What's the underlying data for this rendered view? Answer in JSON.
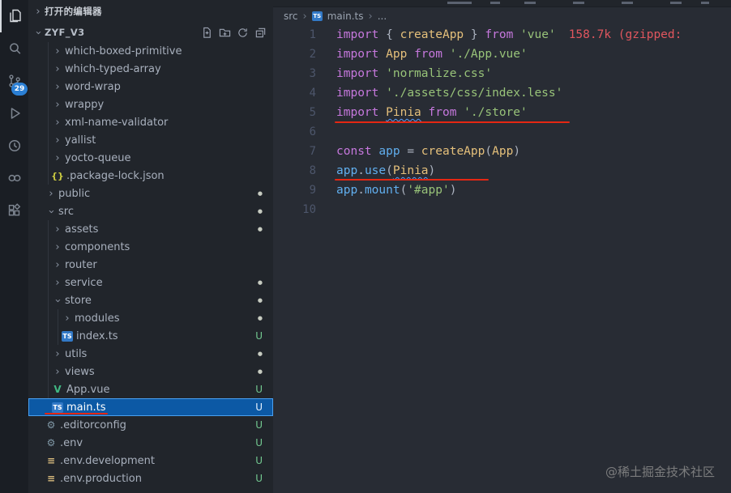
{
  "activity_bar": {
    "source_control_badge": "29",
    "icons": [
      {
        "name": "explorer-icon"
      },
      {
        "name": "search-icon"
      },
      {
        "name": "source-control-icon",
        "badge": "29"
      },
      {
        "name": "run-debug-icon"
      },
      {
        "name": "history-icon"
      },
      {
        "name": "remote-icon"
      },
      {
        "name": "extensions-icon"
      }
    ]
  },
  "sidebar": {
    "open_editors_label": "打开的编辑器",
    "project_name": "ZYF_V3",
    "header_actions": [
      "new-file",
      "new-folder",
      "refresh",
      "collapse-all"
    ],
    "tree": [
      {
        "label": "which-boxed-primitive",
        "level": 2,
        "kind": "folder",
        "state": "collapsed"
      },
      {
        "label": "which-typed-array",
        "level": 2,
        "kind": "folder",
        "state": "collapsed"
      },
      {
        "label": "word-wrap",
        "level": 2,
        "kind": "folder",
        "state": "collapsed"
      },
      {
        "label": "wrappy",
        "level": 2,
        "kind": "folder",
        "state": "collapsed"
      },
      {
        "label": "xml-name-validator",
        "level": 2,
        "kind": "folder",
        "state": "collapsed"
      },
      {
        "label": "yallist",
        "level": 2,
        "kind": "folder",
        "state": "collapsed"
      },
      {
        "label": "yocto-queue",
        "level": 2,
        "kind": "folder",
        "state": "collapsed"
      },
      {
        "label": ".package-lock.json",
        "level": 2,
        "kind": "file",
        "icon": "json"
      },
      {
        "label": "public",
        "level": 1,
        "kind": "folder",
        "state": "collapsed",
        "dot": true
      },
      {
        "label": "src",
        "level": 1,
        "kind": "folder",
        "state": "expanded",
        "dot": true
      },
      {
        "label": "assets",
        "level": 2,
        "kind": "folder",
        "state": "collapsed",
        "dot": true
      },
      {
        "label": "components",
        "level": 2,
        "kind": "folder",
        "state": "collapsed"
      },
      {
        "label": "router",
        "level": 2,
        "kind": "folder",
        "state": "collapsed"
      },
      {
        "label": "service",
        "level": 2,
        "kind": "folder",
        "state": "collapsed",
        "dot": true
      },
      {
        "label": "store",
        "level": 2,
        "kind": "folder",
        "state": "expanded",
        "dot": true
      },
      {
        "label": "modules",
        "level": 3,
        "kind": "folder",
        "state": "collapsed",
        "dot": true
      },
      {
        "label": "index.ts",
        "level": 3,
        "kind": "file",
        "icon": "ts",
        "badge": "U"
      },
      {
        "label": "utils",
        "level": 2,
        "kind": "folder",
        "state": "collapsed",
        "dot": true
      },
      {
        "label": "views",
        "level": 2,
        "kind": "folder",
        "state": "collapsed",
        "dot": true
      },
      {
        "label": "App.vue",
        "level": 2,
        "kind": "file",
        "icon": "vue",
        "badge": "U"
      },
      {
        "label": "main.ts",
        "level": 2,
        "kind": "file",
        "icon": "ts",
        "badge": "U",
        "selected": true,
        "annotated": true
      },
      {
        "label": ".editorconfig",
        "level": 1,
        "kind": "file",
        "icon": "gear",
        "badge": "U"
      },
      {
        "label": ".env",
        "level": 1,
        "kind": "file",
        "icon": "gear",
        "badge": "U"
      },
      {
        "label": ".env.development",
        "level": 1,
        "kind": "file",
        "icon": "sliders",
        "badge": "U"
      },
      {
        "label": ".env.production",
        "level": 1,
        "kind": "file",
        "icon": "sliders",
        "badge": "U"
      }
    ]
  },
  "editor": {
    "breadcrumb": {
      "root": "src",
      "file": "main.ts",
      "more": "..."
    },
    "code": {
      "lines": [
        {
          "num": "1",
          "tokens": [
            {
              "c": "kw",
              "t": "import"
            },
            {
              "c": "pun",
              "t": " { "
            },
            {
              "c": "cls",
              "t": "createApp"
            },
            {
              "c": "pun",
              "t": " } "
            },
            {
              "c": "kw",
              "t": "from"
            },
            {
              "c": "pun",
              "t": " "
            },
            {
              "c": "str",
              "t": "'vue'"
            },
            {
              "c": "hint",
              "t": "158.7k (gzipped: "
            }
          ]
        },
        {
          "num": "2",
          "tokens": [
            {
              "c": "kw",
              "t": "import"
            },
            {
              "c": "pun",
              "t": " "
            },
            {
              "c": "cls",
              "t": "App"
            },
            {
              "c": "pun",
              "t": " "
            },
            {
              "c": "kw",
              "t": "from"
            },
            {
              "c": "pun",
              "t": " "
            },
            {
              "c": "str",
              "t": "'./App.vue'"
            }
          ]
        },
        {
          "num": "3",
          "tokens": [
            {
              "c": "kw",
              "t": "import"
            },
            {
              "c": "pun",
              "t": " "
            },
            {
              "c": "str",
              "t": "'normalize.css'"
            }
          ]
        },
        {
          "num": "4",
          "tokens": [
            {
              "c": "kw",
              "t": "import"
            },
            {
              "c": "pun",
              "t": " "
            },
            {
              "c": "str",
              "t": "'./assets/css/index.less'"
            }
          ]
        },
        {
          "num": "5",
          "tokens": [
            {
              "c": "kw",
              "t": "import"
            },
            {
              "c": "pun",
              "t": " "
            },
            {
              "c": "cls",
              "t": "Pinia",
              "squiggle": true
            },
            {
              "c": "pun",
              "t": " "
            },
            {
              "c": "kw",
              "t": "from"
            },
            {
              "c": "pun",
              "t": " "
            },
            {
              "c": "str",
              "t": "'./store'"
            }
          ],
          "annotated": true
        },
        {
          "num": "6",
          "tokens": []
        },
        {
          "num": "7",
          "tokens": [
            {
              "c": "kw",
              "t": "const"
            },
            {
              "c": "pun",
              "t": " "
            },
            {
              "c": "fn",
              "t": "app"
            },
            {
              "c": "pun",
              "t": " = "
            },
            {
              "c": "cls",
              "t": "createApp"
            },
            {
              "c": "pun",
              "t": "("
            },
            {
              "c": "cls",
              "t": "App"
            },
            {
              "c": "pun",
              "t": ")"
            }
          ]
        },
        {
          "num": "8",
          "tokens": [
            {
              "c": "fn",
              "t": "app"
            },
            {
              "c": "pun",
              "t": "."
            },
            {
              "c": "fn",
              "t": "use"
            },
            {
              "c": "pun",
              "t": "("
            },
            {
              "c": "cls",
              "t": "Pinia",
              "squiggle": true
            },
            {
              "c": "pun",
              "t": ")"
            }
          ],
          "annotated": true
        },
        {
          "num": "9",
          "tokens": [
            {
              "c": "fn",
              "t": "app"
            },
            {
              "c": "pun",
              "t": "."
            },
            {
              "c": "fn",
              "t": "mount"
            },
            {
              "c": "pun",
              "t": "("
            },
            {
              "c": "str",
              "t": "'#app'"
            },
            {
              "c": "pun",
              "t": ")"
            }
          ]
        },
        {
          "num": "10",
          "tokens": []
        }
      ]
    }
  },
  "watermark": "@稀土掘金技术社区",
  "colors": {
    "selection_blue": "#0c59a5",
    "git_untracked_green": "#73c991",
    "annotation_red": "#e52713",
    "import_hint_red": "#e0565e",
    "badge_blue": "#2b7fd4"
  }
}
